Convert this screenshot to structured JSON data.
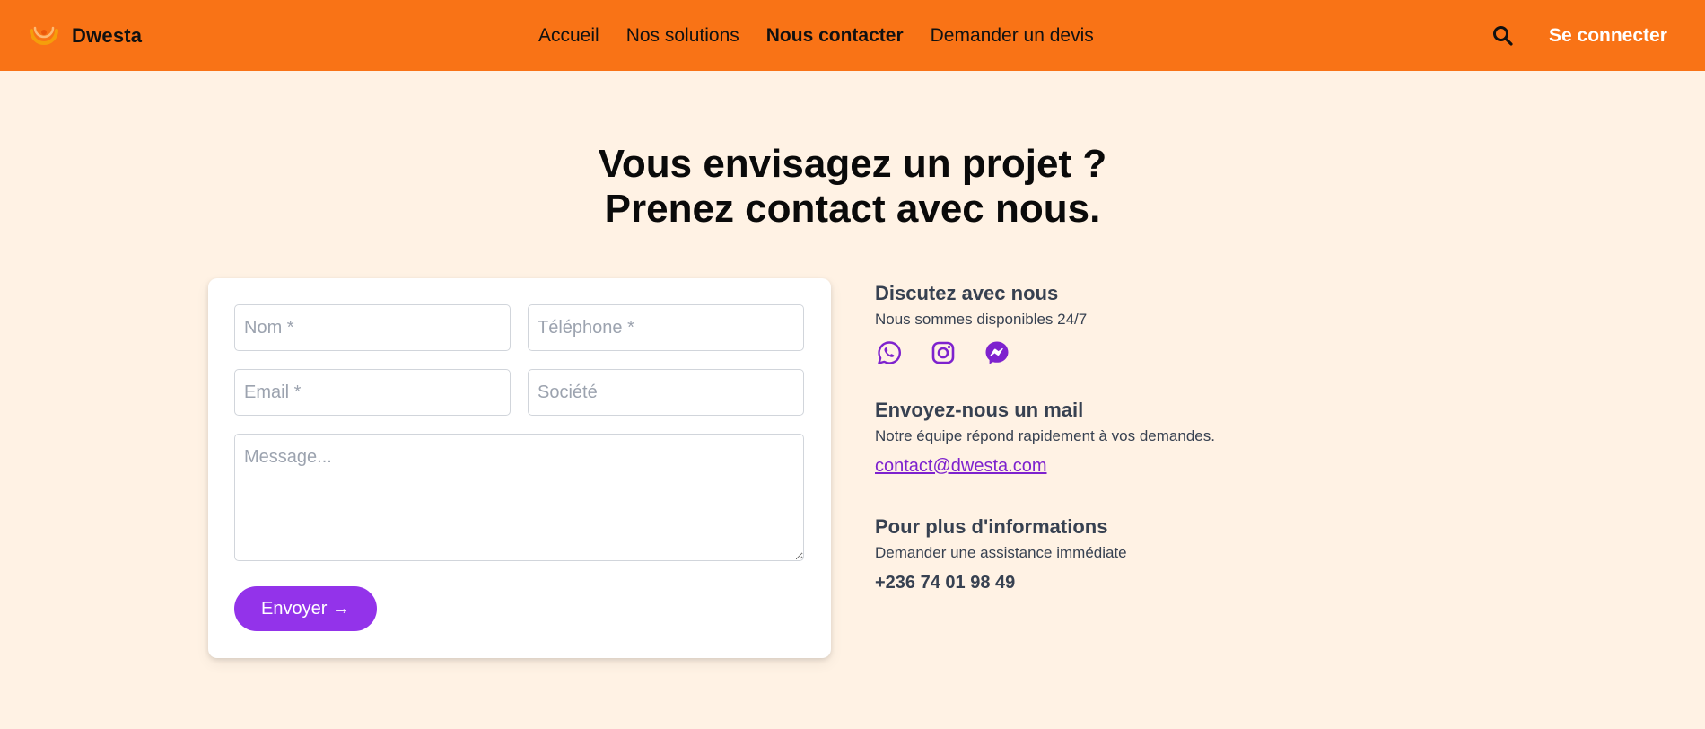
{
  "brand": {
    "name": "Dwesta"
  },
  "nav": {
    "items": [
      {
        "label": "Accueil"
      },
      {
        "label": "Nos solutions"
      },
      {
        "label": "Nous contacter",
        "active": true
      },
      {
        "label": "Demander un devis"
      }
    ],
    "login_label": "Se connecter",
    "search_icon": "search-icon"
  },
  "hero": {
    "line1": "Vous envisagez un projet ?",
    "line2": "Prenez contact avec nous."
  },
  "form": {
    "name_placeholder": "Nom *",
    "phone_placeholder": "Téléphone *",
    "email_placeholder": "Email *",
    "company_placeholder": "Société",
    "message_placeholder": "Message...",
    "submit_label": "Envoyer →"
  },
  "chat": {
    "title": "Discutez avec nous",
    "subtitle": "Nous sommes disponibles 24/7",
    "icons": [
      "whatsapp-icon",
      "instagram-icon",
      "messenger-icon"
    ]
  },
  "mail": {
    "title": "Envoyez-nous un mail",
    "subtitle": "Notre équipe répond rapidement à vos demandes.",
    "email": "contact@dwesta.com"
  },
  "more_info": {
    "title": "Pour plus d'informations",
    "subtitle": "Demander une assistance immédiate",
    "phone": "+236 74 01 98 49"
  },
  "colors": {
    "header_bg": "#F97316",
    "page_bg": "#FFF2E4",
    "accent": "#9333EA",
    "social_icon": "#7E22CE"
  }
}
